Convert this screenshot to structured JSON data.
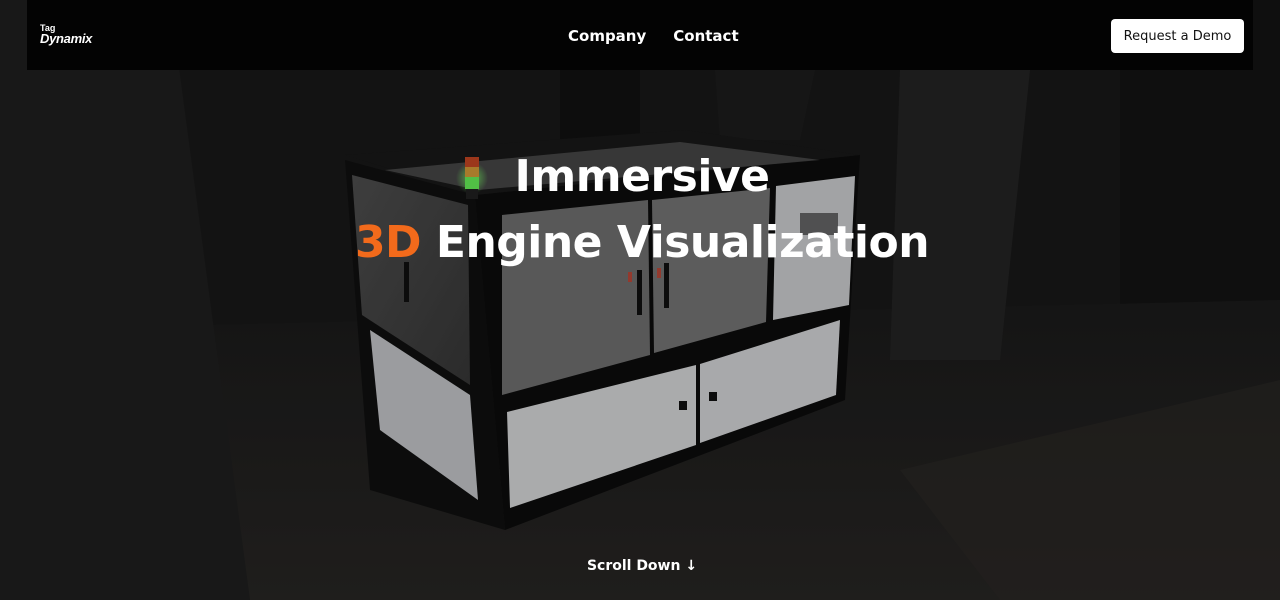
{
  "brand": {
    "logo_small": "Tag",
    "logo_main": "Dynamix"
  },
  "nav": {
    "links": [
      "Company",
      "Contact"
    ],
    "cta_label": "Request a Demo"
  },
  "hero": {
    "line1": "Immersive",
    "line2_accent": "3D",
    "line2_rest": " Engine Visualization",
    "accent_color": "#f26a1b"
  },
  "scroll_hint": "Scroll Down ↓",
  "scene": {
    "subject": "3D rendered machine enclosure cabinet in dark room",
    "signal_light": "green"
  }
}
